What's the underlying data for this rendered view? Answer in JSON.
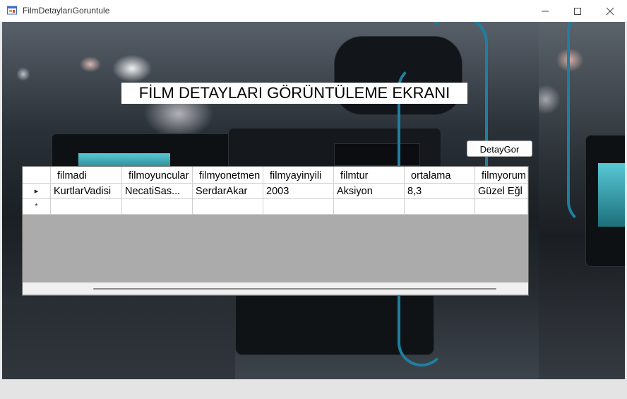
{
  "window": {
    "title": "FilmDetaylarıGoruntule",
    "minimize_glyph": "—",
    "maximize_glyph": "☐",
    "close_glyph": "✕"
  },
  "form": {
    "heading": "FİLM DETAYLARI GÖRÜNTÜLEME EKRANI",
    "detail_button": "DetayGor"
  },
  "grid": {
    "columns": [
      "filmadi",
      "filmoyuncular",
      "filmyonetmen",
      "filmyayinyili",
      "filmtur",
      "ortalama",
      "filmyorum"
    ],
    "rows": [
      {
        "indicator": "▸",
        "cells": [
          "KurtlarVadisi",
          "NecatiSas...",
          "SerdarAkar",
          "2003",
          "Aksiyon",
          "8,3",
          "Güzel Eğl"
        ]
      },
      {
        "indicator": "*",
        "cells": [
          "",
          "",
          "",
          "",
          "",
          "",
          ""
        ]
      }
    ]
  },
  "icons": {
    "app": "app-form-icon",
    "current_row": "row-pointer-icon",
    "new_row": "new-row-asterisk-icon"
  }
}
